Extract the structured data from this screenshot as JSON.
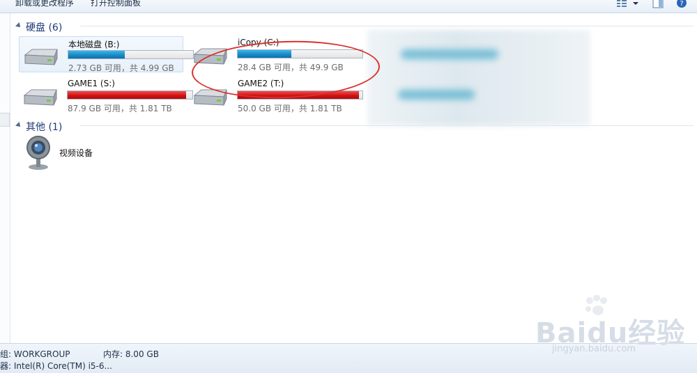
{
  "toolbar": {
    "uninstall_label": "卸载或更改程序",
    "control_panel_label": "打开控制面板",
    "view_icon": "view-options-icon",
    "dropdown_icon": "chevron-down-icon",
    "preview_icon": "preview-pane-icon",
    "help_icon": "help-icon"
  },
  "groups": {
    "drives": {
      "title": "硬盘 (6)"
    },
    "other": {
      "title": "其他 (1)"
    }
  },
  "drives": [
    {
      "name": "本地磁盘 (B:)",
      "info": "2.73 GB 可用，共 4.99 GB",
      "used_fraction": 0.45,
      "color": "#1a8bc7"
    },
    {
      "name": "iCopy (C:)",
      "info": "28.4 GB 可用，共 49.9 GB",
      "used_fraction": 0.43,
      "color": "#1a8bc7"
    },
    {
      "name": "GAME1 (S:)",
      "info": "87.9 GB 可用，共 1.81 TB",
      "used_fraction": 0.95,
      "color": "#d41212"
    },
    {
      "name": "GAME2 (T:)",
      "info": "50.0 GB 可用，共 1.81 TB",
      "used_fraction": 0.97,
      "color": "#d41212"
    }
  ],
  "other_devices": [
    {
      "name": "视频设备",
      "icon": "webcam-icon"
    }
  ],
  "status": {
    "workgroup": "组: WORKGROUP",
    "memory": "内存: 8.00 GB",
    "processor": "器: Intel(R) Core(TM) i5-6..."
  },
  "watermark": {
    "brand": "Baidu经验",
    "url": "jingyan.baidu.com"
  },
  "colors": {
    "usage_normal": "#1a8bc7",
    "usage_full": "#d41212",
    "annotation": "#d9312c",
    "group_title": "#1e3a78"
  }
}
